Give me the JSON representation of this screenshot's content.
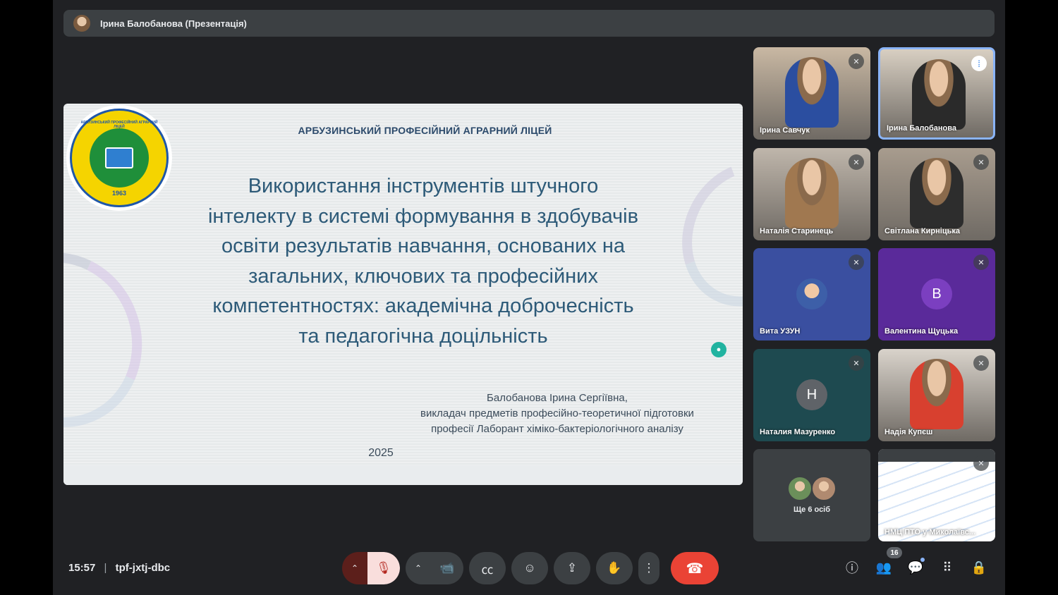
{
  "presenter": {
    "name": "Ірина Балобанова (Презентація)"
  },
  "slide": {
    "school": "АРБУЗИНСЬКИЙ ПРОФЕСІЙНИЙ АГРАРНИЙ ЛІЦЕЙ",
    "logo_text": "АРБУЗИНСЬКИЙ ПРОФЕСІЙНИЙ АГРАРНИЙ ЛІЦЕЙ",
    "logo_year": "1963",
    "title_lines": [
      "Використання інструментів штучного",
      "інтелекту в системі формування в здобувачів",
      "освіти результатів навчання, основаних на",
      "загальних, ключових та професійних",
      "компетентностях: академічна доброчесність",
      "та педагогічна доцільність"
    ],
    "author_lines": [
      "Балобанова Ірина Сергіївна,",
      "викладач предметів професійно-теоретичної підготовки",
      "професії Лаборант хіміко-бактеріологічного аналізу"
    ],
    "year": "2025"
  },
  "participants": [
    {
      "name": "Ірина Савчук",
      "type": "video",
      "mic": "muted",
      "bg": "#c9b8a3",
      "shirt": "#2b4ea0"
    },
    {
      "name": "Ірина Балобанова",
      "type": "video",
      "mic": "speaking",
      "bg": "#d8cfc2",
      "shirt": "#2a2a2a"
    },
    {
      "name": "Наталія Старинець",
      "type": "video",
      "mic": "muted",
      "bg": "#bfb6ab",
      "shirt": "#a07850"
    },
    {
      "name": "Світлана Кирніцька",
      "type": "video",
      "mic": "muted",
      "bg": "#a89c8e",
      "shirt": "#2d2d2d"
    },
    {
      "name": "Вита УЗУН",
      "type": "photo-avatar",
      "mic": "muted",
      "bg": "#3a4fa0"
    },
    {
      "name": "Валентина Щуцька",
      "type": "letter",
      "letter": "В",
      "mic": "muted",
      "bg": "#5a2a9a",
      "avatar_color": "#7b3fc0"
    },
    {
      "name": "Наталия Мазуренко",
      "type": "letter",
      "letter": "Н",
      "mic": "muted",
      "bg": "#1e4a50",
      "avatar_color": "#5f6368"
    },
    {
      "name": "Надія Купєш",
      "type": "video",
      "mic": "muted",
      "bg": "#d9d3cb",
      "shirt": "#d8402f"
    },
    {
      "name": "Ще 6 осіб",
      "type": "more",
      "bg": "#3c4043"
    },
    {
      "name": "НМЦ ПТО у Миколаївс...",
      "type": "document",
      "mic": "muted"
    }
  ],
  "meeting": {
    "time": "15:57",
    "separator": "|",
    "code": "tpf-jxtj-dbc"
  },
  "controls": {
    "mic_chevron": "⌃",
    "mic_icon": "🎙",
    "cam_chevron": "⌃",
    "cam_icon": "📹",
    "captions_icon": "㏄",
    "emoji_icon": "☺",
    "present_icon": "⇪",
    "hand_icon": "✋",
    "more_icon": "⋮",
    "end_icon": "☎"
  },
  "right_toolbar": {
    "info_icon": "ⓘ",
    "people_icon": "👥",
    "people_count": "16",
    "chat_icon": "💬",
    "activities_icon": "⠿",
    "host_icon": "🔒"
  },
  "colors": {
    "stage": "#202124",
    "end_call": "#ea4335",
    "active_border": "#8ab4f8",
    "slide_title": "#2d5a78"
  }
}
